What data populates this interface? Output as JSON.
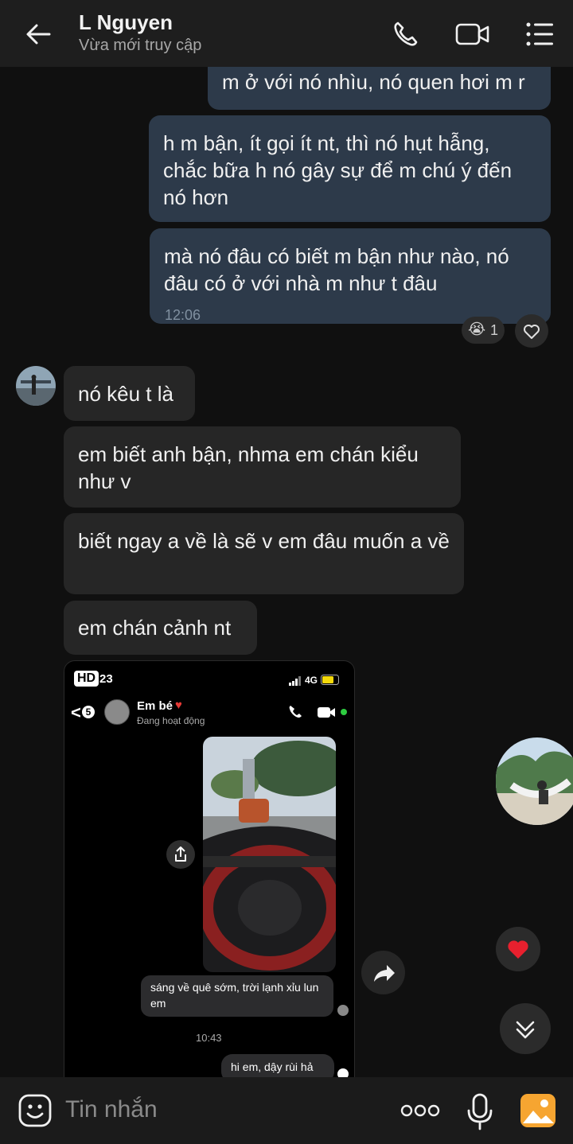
{
  "header": {
    "contact_name": "L Nguyen",
    "status": "Vừa mới truy cập",
    "icons": [
      "back-arrow-icon",
      "phone-icon",
      "video-call-icon",
      "menu-list-icon"
    ]
  },
  "messages": [
    {
      "dir": "out",
      "text": "m ở với nó nhìu, nó quen hơi m r"
    },
    {
      "dir": "out",
      "text": "h m bận, ít gọi ít nt, thì nó hụt hẫng, chắc bữa h nó gây sự để m chú ý đến nó hơn"
    },
    {
      "dir": "out",
      "text": "mà nó đâu có biết m bận như nào, nó đâu có ở với nhà m như t đâu",
      "time": "12:06",
      "reaction": {
        "emoji": "😭",
        "count": "1"
      }
    },
    {
      "dir": "in",
      "text": "nó kêu t là"
    },
    {
      "dir": "in",
      "text": "em biết anh bận, nhma em chán kiểu như v"
    },
    {
      "dir": "in",
      "text": "biết ngay a về là sẽ v em đâu muốn a về"
    },
    {
      "dir": "in",
      "text": "em chán cảnh nt"
    }
  ],
  "photo": {
    "hd_badge": "HD",
    "status_time": "23",
    "network": "4G",
    "back_count": "5",
    "chat_name": "Em bé",
    "chat_status": "Đang hoạt động",
    "caption": "sáng về quê sớm, trời lạnh xỉu lun em",
    "time": "10:43",
    "reply": "hi em, dậy rùi hả"
  },
  "composer": {
    "placeholder": "Tin nhắn",
    "icons": [
      "sticker-icon",
      "more-dots-icon",
      "microphone-icon",
      "gallery-icon"
    ]
  },
  "colors": {
    "outgoing_bubble": "#2d3a4a",
    "incoming_bubble": "#262626",
    "background": "#101010",
    "heart": "#e8202e"
  }
}
